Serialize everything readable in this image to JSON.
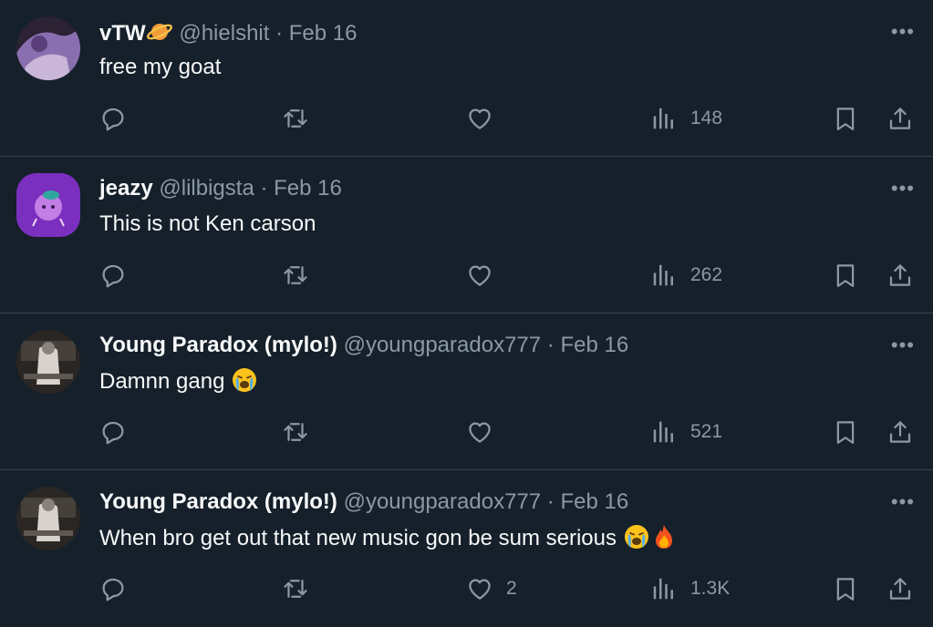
{
  "posts": [
    {
      "name": "vTW",
      "name_emoji": "ringed-planet",
      "handle": "@hielshit",
      "date": "Feb 16",
      "text": "free my goat",
      "text_emojis": [],
      "stats": {
        "reply": "",
        "repost": "",
        "like": "",
        "views": "148"
      },
      "avatar_colors": [
        "#3a2a4a",
        "#8a6fb0",
        "#c9b6d8"
      ]
    },
    {
      "name": "jeazy",
      "handle": "@lilbigsta",
      "date": "Feb 16",
      "text": "This is not Ken carson",
      "text_emojis": [],
      "stats": {
        "reply": "",
        "repost": "",
        "like": "",
        "views": "262"
      },
      "avatar_colors": [
        "#7b2fbe",
        "#c37ee6",
        "#2fa7a0"
      ]
    },
    {
      "name": "Young Paradox (mylo!)",
      "handle": "@youngparadox777",
      "date": "Feb 16",
      "text": "Damnn gang",
      "text_emojis": [
        "loudly-crying-face"
      ],
      "stats": {
        "reply": "",
        "repost": "",
        "like": "",
        "views": "521"
      },
      "avatar_colors": [
        "#2a2623",
        "#d8d2cc",
        "#8a817a"
      ]
    },
    {
      "name": "Young Paradox (mylo!)",
      "handle": "@youngparadox777",
      "date": "Feb 16",
      "text": "When bro get out that new music gon be sum serious",
      "text_emojis": [
        "loudly-crying-face",
        "fire"
      ],
      "stats": {
        "reply": "",
        "repost": "",
        "like": "2",
        "views": "1.3K"
      },
      "avatar_colors": [
        "#2a2623",
        "#d8d2cc",
        "#8a817a"
      ]
    }
  ],
  "separator": "·",
  "more_label": "•••",
  "colors": {
    "background": "#15202b",
    "secondary_text": "#8b98a5",
    "divider": "#38444d",
    "primary_text": "#f7f9f9"
  }
}
